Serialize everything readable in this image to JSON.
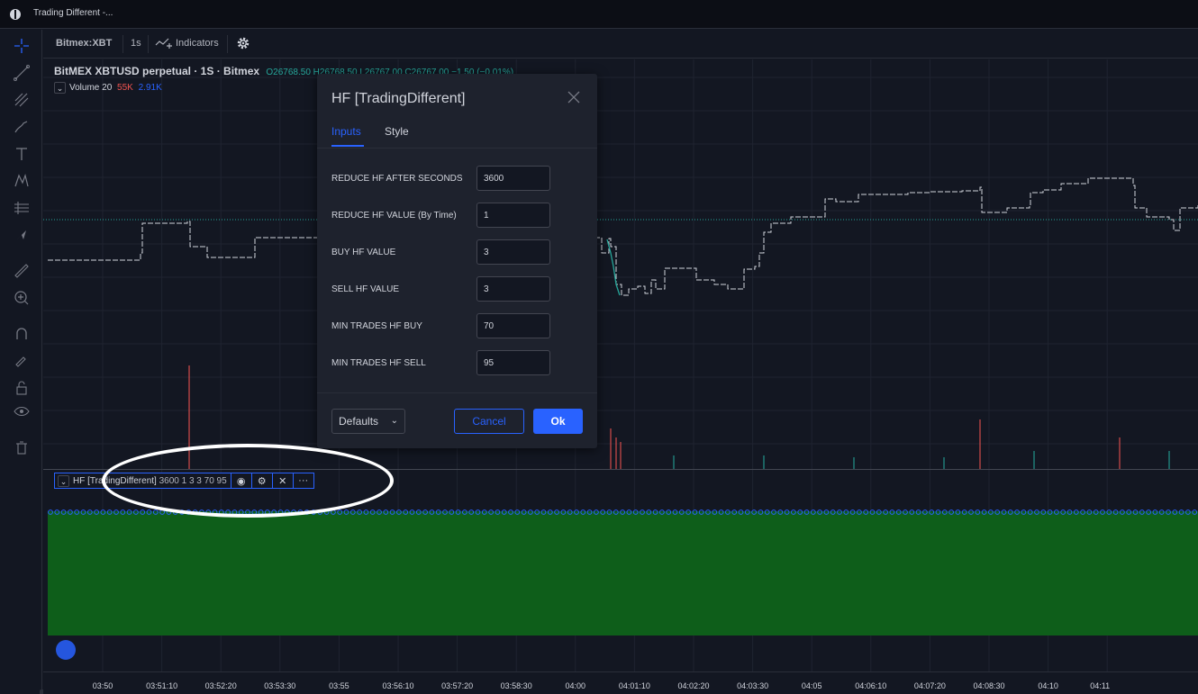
{
  "window": {
    "title": "Trading Different -..."
  },
  "toolbar": {
    "symbol": "Bitmex:XBT",
    "interval": "1s",
    "indicators_label": "Indicators"
  },
  "legend": {
    "symbol_line": "BitMEX XBTUSD perpetual · 1S · Bitmex",
    "ohlc": "O26768.50 H26768.50 L26767.00 C26767.00 −1.50 (−0.01%)",
    "volume_label": "Volume 20",
    "volume_v1": "55K",
    "volume_v2": "2.91K"
  },
  "hf_legend": {
    "label": "HF [TradingDifferent]",
    "values": "3600 1 3 3 70 95"
  },
  "dialog": {
    "title": "HF [TradingDifferent]",
    "tabs": [
      {
        "label": "Inputs"
      },
      {
        "label": "Style"
      }
    ],
    "inputs": [
      {
        "label": "REDUCE HF AFTER SECONDS",
        "value": "3600"
      },
      {
        "label": "REDUCE HF VALUE (By Time)",
        "value": "1"
      },
      {
        "label": "BUY HF VALUE",
        "value": "3"
      },
      {
        "label": "SELL HF VALUE",
        "value": "3"
      },
      {
        "label": "MIN TRADES HF BUY",
        "value": "70"
      },
      {
        "label": "MIN TRADES HF SELL",
        "value": "95"
      }
    ],
    "defaults_label": "Defaults",
    "cancel_label": "Cancel",
    "ok_label": "Ok"
  },
  "time_axis": {
    "labels": [
      "03:50",
      "03:51:10",
      "03:52:20",
      "03:53:30",
      "03:55",
      "03:56:10",
      "03:57:20",
      "03:58:30",
      "04:00",
      "04:01:10",
      "04:02:20",
      "04:03:30",
      "04:05",
      "04:06:10",
      "04:07:20",
      "04:08:30",
      "04:10",
      "04:11"
    ]
  },
  "colors": {
    "background": "#131722",
    "accent": "#2962ff",
    "green_fill": "#0e5e1a",
    "up": "#26a69a",
    "down": "#ef5350"
  }
}
